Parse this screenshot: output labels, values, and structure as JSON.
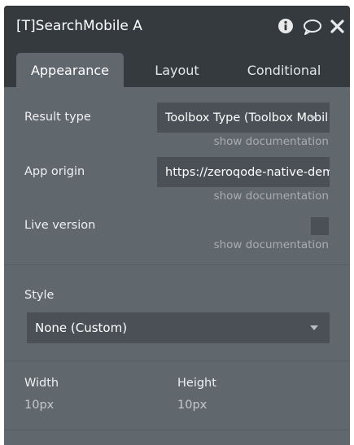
{
  "window": {
    "title": "[T]SearchMobile A"
  },
  "icons": {
    "info": "info-icon",
    "comment": "comment-icon",
    "close": "close-icon"
  },
  "tabs": [
    {
      "label": "Appearance",
      "active": true
    },
    {
      "label": "Layout",
      "active": false
    },
    {
      "label": "Conditional",
      "active": false
    }
  ],
  "fields": {
    "result_type": {
      "label": "Result type",
      "value": "Toolbox Type (Toolbox Mobil",
      "doc": "show documentation"
    },
    "app_origin": {
      "label": "App origin",
      "value": "https://zeroqode-native-dem",
      "doc": "show documentation"
    },
    "live_version": {
      "label": "Live version",
      "checked": false,
      "doc": "show documentation"
    }
  },
  "style": {
    "label": "Style",
    "value": "None (Custom)"
  },
  "dimensions": {
    "width_label": "Width",
    "width_value": "10px",
    "height_label": "Height",
    "height_value": "10px"
  },
  "colors": {
    "titlebar": "#353a3e",
    "panel": "#60676d",
    "field": "#4a5056"
  }
}
